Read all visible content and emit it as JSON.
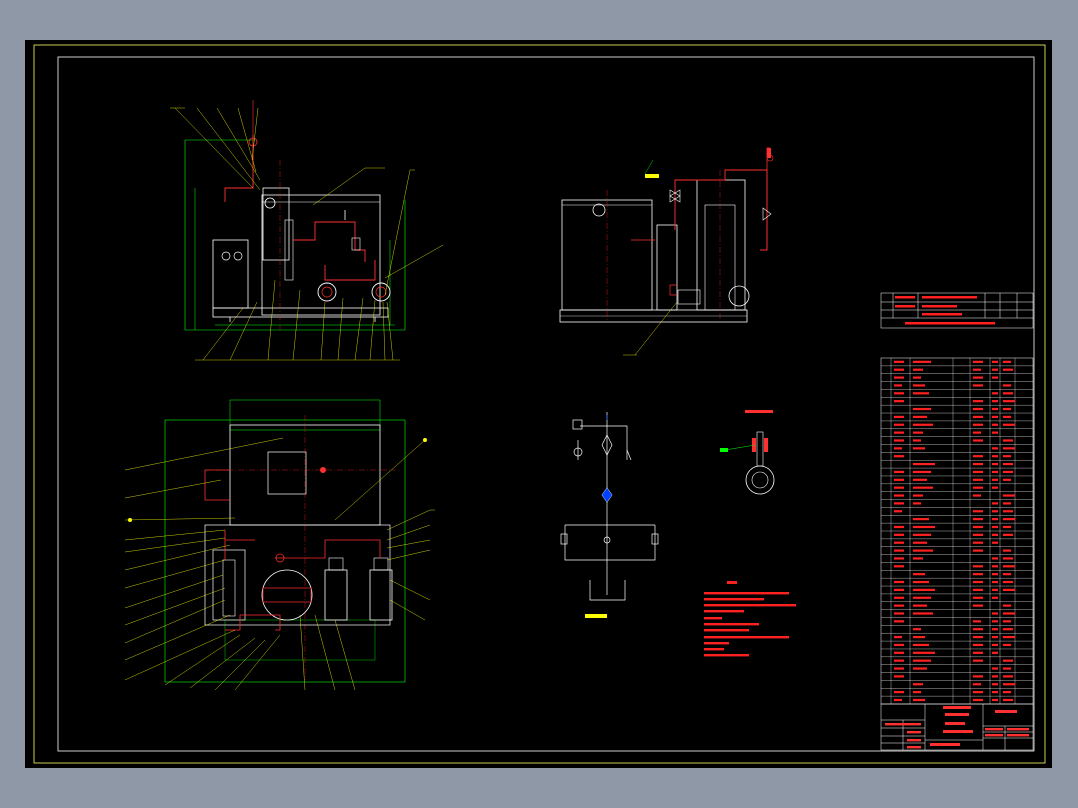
{
  "drawing": {
    "colors": {
      "background": "#000000",
      "frame": "#ffff66",
      "geometry": "#ffffff",
      "leaders": "#ffff00",
      "dimensions": "#00ff00",
      "centerlines": "#ff2020",
      "piping": "#ff3030",
      "notes": "#ff2020"
    },
    "views": [
      {
        "name": "front-elevation"
      },
      {
        "name": "side-elevation"
      },
      {
        "name": "plan-view"
      },
      {
        "name": "hydraulic-schematic"
      },
      {
        "name": "detail-view"
      }
    ]
  }
}
